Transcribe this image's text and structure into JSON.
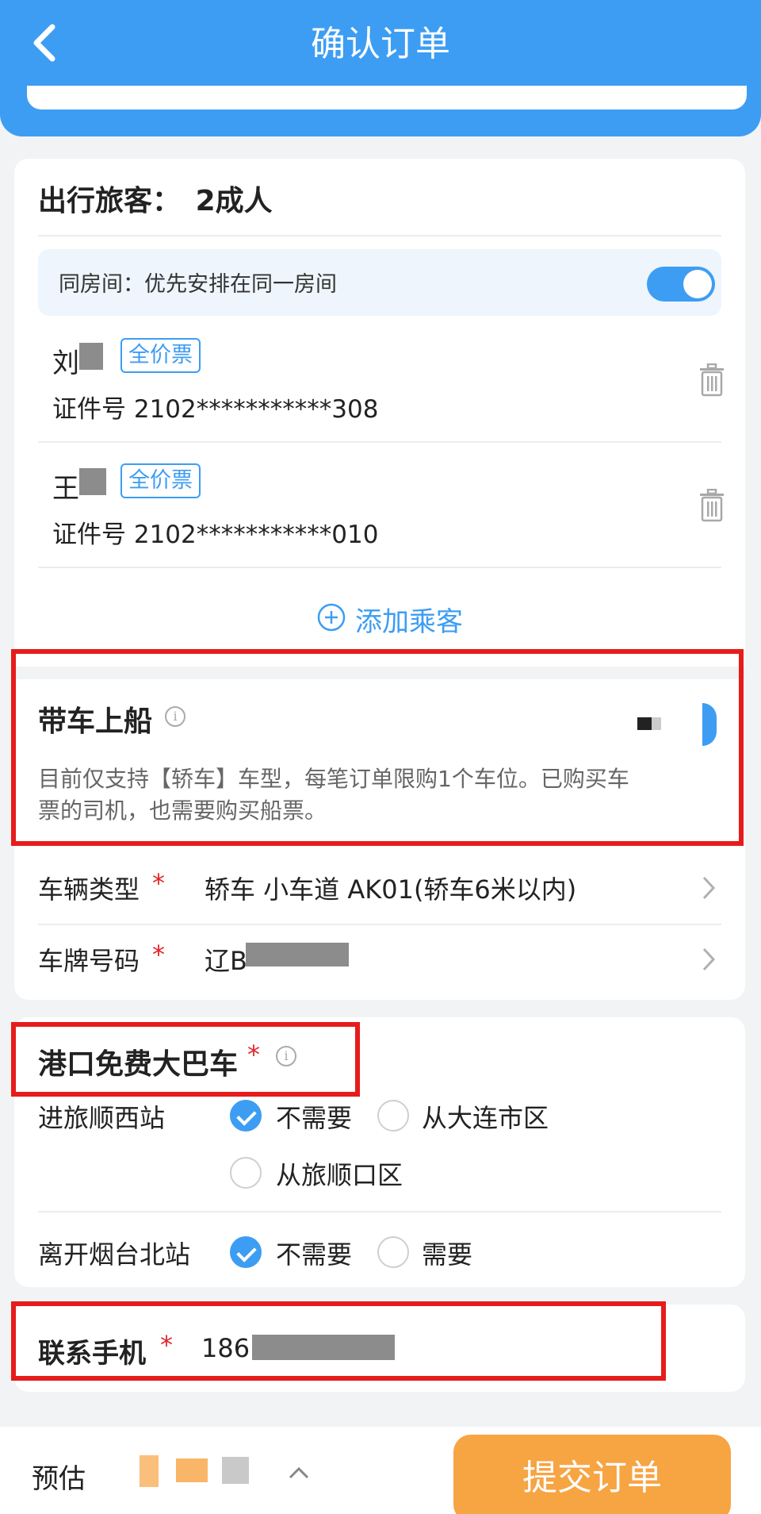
{
  "header": {
    "title": "确认订单"
  },
  "passengers": {
    "label": "出行旅客：",
    "count": "2成人",
    "room_text": "同房间：优先安排在同一房间",
    "room_toggle_on": true,
    "list": [
      {
        "name": "刘",
        "ticket": "全价票",
        "id": "证件号 2102***********308"
      },
      {
        "name": "王",
        "ticket": "全价票",
        "id": "证件号 2102***********010"
      }
    ],
    "add_label": "添加乘客"
  },
  "car": {
    "title": "带车上船",
    "desc1": "目前仅支持【轿车】车型，每笔订单限购1个车位。已购买车",
    "desc2": "票的司机，也需要购买船票。",
    "type_label": "车辆类型",
    "type_value": "轿车 小车道 AK01(轿车6米以内)",
    "plate_label": "车牌号码",
    "plate_value": "辽B"
  },
  "bus": {
    "title": "港口免费大巴车",
    "in_label": "进旅顺西站",
    "in_options": [
      "不需要",
      "从大连市区",
      "从旅顺口区"
    ],
    "in_selected": 0,
    "out_label": "离开烟台北站",
    "out_options": [
      "不需要",
      "需要"
    ],
    "out_selected": 0
  },
  "contact": {
    "label": "联系手机",
    "value": "186"
  },
  "footer": {
    "estimate": "预估",
    "submit": "提交订单"
  },
  "colors": {
    "primary": "#3d9df3",
    "submit": "#f7a443",
    "highlight": "#e61c1c"
  }
}
